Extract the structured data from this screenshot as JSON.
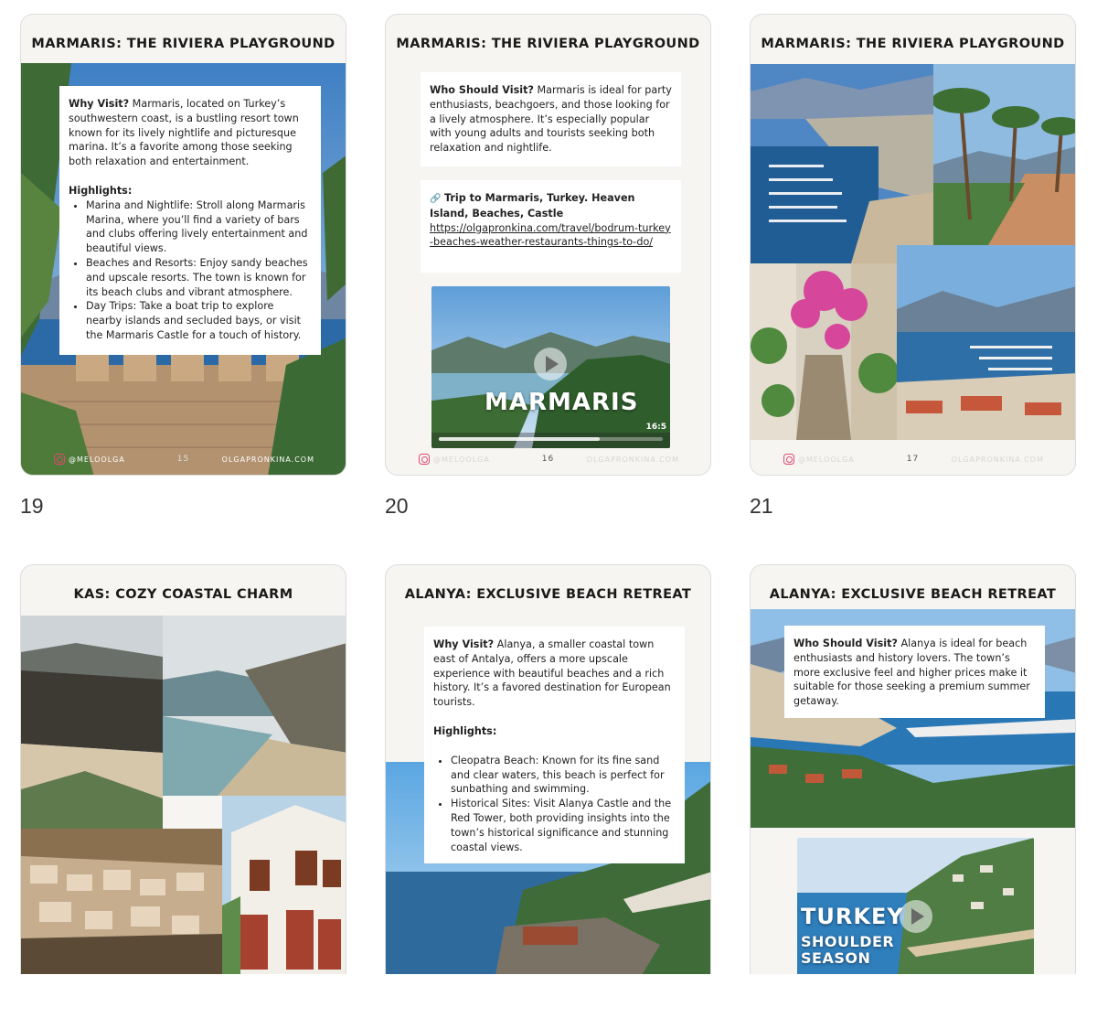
{
  "pages": [
    {
      "number": "19",
      "title": "MARMARIS: THE RIVIERA PLAYGROUND",
      "why_label": "Why Visit?",
      "why_text": " Marmaris, located on Turkey’s southwestern coast, is a bustling resort town known for its lively nightlife and picturesque marina. It’s a favorite among those seeking both relaxation and entertainment.",
      "highlights_label": "Highlights:",
      "highlights": [
        "Marina and Nightlife: Stroll along Marmaris Marina, where you’ll find a variety of bars and clubs offering lively entertainment and beautiful views.",
        "Beaches and Resorts: Enjoy sandy beaches and upscale resorts. The town is known for its beach clubs and vibrant atmosphere.",
        "Day Trips: Take a boat trip to explore nearby islands and secluded bays, or visit the Marmaris Castle for a touch of history."
      ],
      "footer_handle": "@MELOOLGA",
      "footer_num": "15",
      "footer_site": "OLGAPRONKINA.COM"
    },
    {
      "number": "20",
      "title": "MARMARIS: THE RIVIERA PLAYGROUND",
      "who_label": "Who Should Visit?",
      "who_text": " Marmaris is ideal for party enthusiasts, beachgoers, and those looking for a lively atmosphere. It’s especially popular with young adults and tourists seeking both relaxation and nightlife.",
      "link_icon": "🔗",
      "link_title": "Trip to Marmaris, Turkey. Heaven Island, Beaches, Castle",
      "link_url": "https://olgapronkina.com/travel/bodrum-turkey-beaches-weather-restaurants-things-to-do/",
      "video_caption": "MARMARIS",
      "video_duration": "16:5",
      "video_progress": 0.72,
      "footer_handle": "@MELOOLGA",
      "footer_num": "16",
      "footer_site": "OLGAPRONKINA.COM"
    },
    {
      "number": "21",
      "title": "MARMARIS: THE RIVIERA PLAYGROUND",
      "footer_handle": "@MELOOLGA",
      "footer_num": "17",
      "footer_site": "OLGAPRONKINA.COM"
    },
    {
      "title": "KAS: COZY COASTAL CHARM"
    },
    {
      "title": "ALANYA: EXCLUSIVE BEACH RETREAT",
      "why_label": "Why Visit?",
      "why_text": " Alanya, a smaller coastal town east of Antalya, offers a more upscale experience with beautiful beaches and a rich history. It’s a favored destination for European tourists.",
      "highlights_label": "Highlights:",
      "highlights": [
        "Cleopatra Beach: Known for its fine sand and clear waters, this beach is perfect for sunbathing and swimming.",
        "Historical Sites: Visit Alanya Castle and the Red Tower, both providing insights into the town’s historical significance and stunning coastal views."
      ]
    },
    {
      "title": "ALANYA: EXCLUSIVE BEACH RETREAT",
      "who_label": "Who Should Visit?",
      "who_text": " Alanya is ideal for beach enthusiasts and history lovers. The town’s more exclusive feel and higher prices make it suitable for those seeking a premium summer getaway.",
      "video_caption_1": "TURKEY",
      "video_caption_2": "SHOULDER",
      "video_caption_3": "SEASON"
    }
  ]
}
